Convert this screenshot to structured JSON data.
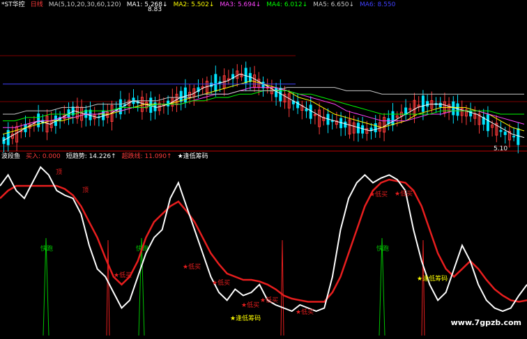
{
  "top_legend": {
    "items": [
      {
        "text": "*ST华控",
        "color": "#ffffff"
      },
      {
        "text": "日线",
        "color": "#ff3b3b"
      },
      {
        "text": "MA(5,10,20,30,60,120)",
        "color": "#c8c8c8"
      },
      {
        "text": "MA1: 5.268↓",
        "color": "#ffffff"
      },
      {
        "text": "MA2: 5.502↓",
        "color": "#ffff00"
      },
      {
        "text": "MA3: 5.694↓",
        "color": "#ff44ff"
      },
      {
        "text": "MA4: 6.012↓",
        "color": "#00ff00"
      },
      {
        "text": "MA5: 6.650↓",
        "color": "#c8c8c8"
      },
      {
        "text": "MA6: 8.550",
        "color": "#4040ff"
      }
    ]
  },
  "bottom_legend": {
    "items": [
      {
        "text": "波段鱼",
        "color": "#ffffff"
      },
      {
        "text": "买入: 0.000",
        "color": "#ff3b3b"
      },
      {
        "text": "短趋势: 14.226↑",
        "color": "#ffffff"
      },
      {
        "text": "超跌线: 11.090↑",
        "color": "#ff3b3b"
      },
      {
        "text": "★逢低筹码",
        "color": "#ffffff"
      }
    ]
  },
  "price_labels": {
    "high": "8.83",
    "low": "5.10"
  },
  "watermark": "www.7gpzb.com",
  "colors": {
    "up": "#ff3b3b",
    "down": "#00e5ff",
    "short": "#ffffff",
    "over": "#e81e1e",
    "signal": "#00c800",
    "star": "#ffff00",
    "grid": "#800000"
  },
  "chart_data": [
    {
      "type": "line",
      "title": "*ST华控 日线",
      "series": [
        {
          "name": "MA1",
          "values": [
            5.2,
            5.4,
            5.6,
            5.8,
            5.7,
            5.9,
            6.1,
            6.0,
            5.9,
            6.0,
            6.2,
            6.4,
            6.3,
            6.2,
            6.3,
            6.5,
            6.6,
            6.8,
            6.9,
            7.0,
            7.2,
            7.1,
            6.9,
            6.7,
            6.5,
            6.3,
            6.1,
            5.9,
            5.8,
            5.7,
            5.6,
            5.5,
            5.6,
            5.8,
            6.0,
            6.2,
            6.3,
            6.3,
            6.2,
            6.1,
            6.0,
            5.8,
            5.6,
            5.4,
            5.3
          ]
        },
        {
          "name": "MA2",
          "values": [
            5.4,
            5.5,
            5.6,
            5.7,
            5.8,
            5.8,
            5.9,
            6.0,
            6.0,
            6.0,
            6.1,
            6.2,
            6.3,
            6.3,
            6.3,
            6.4,
            6.5,
            6.6,
            6.7,
            6.8,
            6.9,
            7.0,
            6.9,
            6.8,
            6.7,
            6.5,
            6.4,
            6.2,
            6.0,
            5.9,
            5.8,
            5.7,
            5.6,
            5.7,
            5.8,
            6.0,
            6.1,
            6.2,
            6.2,
            6.2,
            6.1,
            6.0,
            5.8,
            5.6,
            5.5
          ]
        },
        {
          "name": "MA3",
          "values": [
            5.6,
            5.6,
            5.7,
            5.8,
            5.8,
            5.9,
            5.9,
            6.0,
            6.0,
            6.1,
            6.1,
            6.2,
            6.2,
            6.3,
            6.3,
            6.3,
            6.4,
            6.5,
            6.6,
            6.6,
            6.7,
            6.8,
            6.8,
            6.8,
            6.7,
            6.6,
            6.5,
            6.4,
            6.3,
            6.1,
            6.0,
            5.9,
            5.8,
            5.8,
            5.8,
            5.9,
            6.0,
            6.0,
            6.1,
            6.1,
            6.1,
            6.0,
            5.9,
            5.8,
            5.7
          ]
        },
        {
          "name": "MA4",
          "values": [
            5.8,
            5.8,
            5.9,
            5.9,
            6.0,
            6.0,
            6.0,
            6.1,
            6.1,
            6.1,
            6.2,
            6.2,
            6.2,
            6.3,
            6.3,
            6.3,
            6.4,
            6.4,
            6.5,
            6.5,
            6.6,
            6.6,
            6.7,
            6.7,
            6.7,
            6.6,
            6.6,
            6.5,
            6.4,
            6.3,
            6.2,
            6.1,
            6.0,
            6.0,
            6.0,
            6.0,
            6.0,
            6.1,
            6.1,
            6.1,
            6.1,
            6.1,
            6.0,
            6.0,
            6.0
          ]
        },
        {
          "name": "MA5",
          "values": [
            6.0,
            6.0,
            6.1,
            6.1,
            6.1,
            6.2,
            6.2,
            6.2,
            6.3,
            6.3,
            6.3,
            6.4,
            6.4,
            6.4,
            6.5,
            6.5,
            6.5,
            6.6,
            6.6,
            6.6,
            6.7,
            6.7,
            6.7,
            6.7,
            6.8,
            6.8,
            6.8,
            6.8,
            6.8,
            6.7,
            6.7,
            6.7,
            6.6,
            6.6,
            6.6,
            6.6,
            6.6,
            6.6,
            6.6,
            6.6,
            6.6,
            6.6,
            6.6,
            6.6,
            6.6
          ]
        },
        {
          "name": "MA6",
          "values": [
            6.9,
            6.9,
            6.9,
            6.9,
            6.9,
            6.9,
            6.9,
            6.9,
            6.9,
            6.9,
            6.9,
            6.9,
            6.9,
            6.9,
            6.9,
            6.9,
            6.9,
            6.9,
            6.9,
            6.9,
            6.9,
            6.9,
            6.9,
            6.9,
            6.9,
            6.9,
            6.9,
            6.9,
            6.9,
            6.9,
            6.9,
            6.9,
            6.9,
            6.9,
            6.9,
            6.9,
            6.9,
            6.9,
            6.9,
            6.9,
            6.9,
            6.9,
            6.9,
            6.9,
            6.9
          ]
        }
      ],
      "ylim": [
        5.0,
        9.0
      ]
    },
    {
      "type": "line",
      "title": "波段鱼",
      "series": [
        {
          "name": "短趋势",
          "values": [
            88,
            95,
            85,
            80,
            90,
            100,
            95,
            85,
            82,
            80,
            70,
            50,
            35,
            30,
            20,
            10,
            15,
            30,
            45,
            55,
            60,
            80,
            90,
            75,
            60,
            45,
            30,
            20,
            15,
            22,
            18,
            20,
            25,
            15,
            12,
            10,
            8,
            12,
            10,
            8,
            10,
            30,
            60,
            80,
            90,
            95,
            90,
            93,
            95,
            92,
            85,
            60,
            40,
            25,
            15,
            20,
            35,
            50,
            40,
            25,
            15,
            10,
            8,
            10,
            18,
            25
          ]
        },
        {
          "name": "超跌线",
          "values": [
            80,
            85,
            88,
            88,
            88,
            88,
            88,
            88,
            86,
            82,
            75,
            65,
            55,
            42,
            30,
            25,
            30,
            40,
            55,
            65,
            70,
            75,
            78,
            72,
            65,
            55,
            45,
            38,
            32,
            30,
            28,
            28,
            27,
            25,
            22,
            18,
            16,
            15,
            14,
            14,
            14,
            20,
            30,
            45,
            60,
            75,
            85,
            90,
            92,
            91,
            90,
            85,
            75,
            60,
            45,
            35,
            30,
            35,
            40,
            35,
            28,
            22,
            18,
            15,
            14,
            15
          ]
        }
      ],
      "ylim": [
        0,
        100
      ],
      "annotations": [
        {
          "text": "顶",
          "type": "top"
        },
        {
          "text": "低买",
          "type": "buy"
        },
        {
          "text": "快跑",
          "type": "signal"
        },
        {
          "text": "逢低筹码",
          "type": "star"
        }
      ]
    }
  ]
}
